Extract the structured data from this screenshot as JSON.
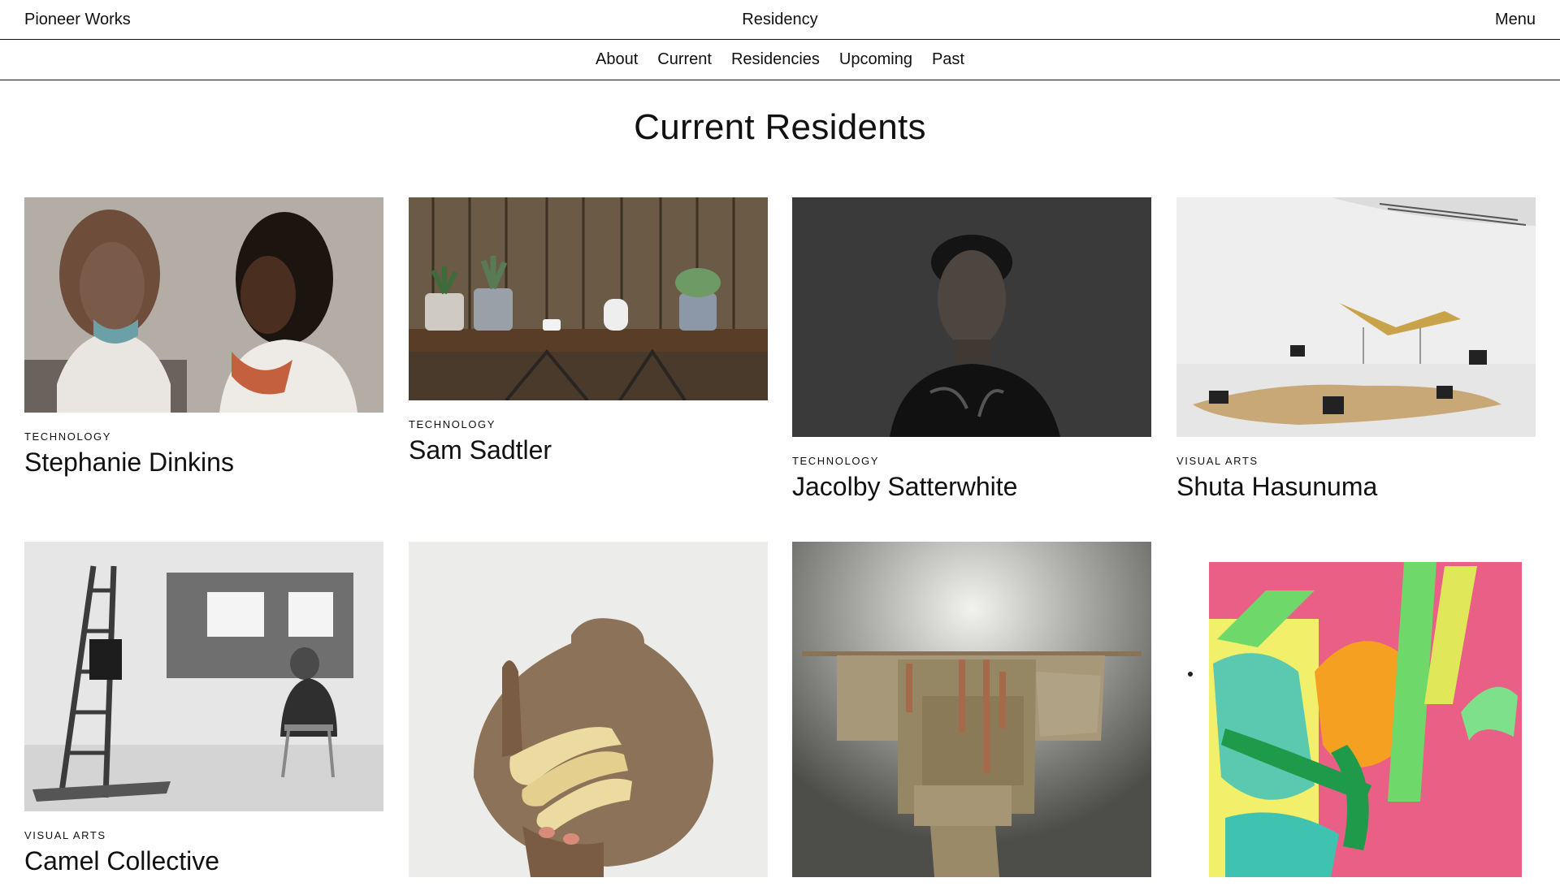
{
  "header": {
    "brand": "Pioneer Works",
    "title": "Residency",
    "menu_label": "Menu"
  },
  "subnav": {
    "items": [
      "About",
      "Current",
      "Residencies",
      "Upcoming",
      "Past"
    ]
  },
  "page_title": "Current Residents",
  "residents": [
    {
      "category": "TECHNOLOGY",
      "name": "Stephanie Dinkins"
    },
    {
      "category": "TECHNOLOGY",
      "name": "Sam Sadtler"
    },
    {
      "category": "TECHNOLOGY",
      "name": "Jacolby Satterwhite"
    },
    {
      "category": "VISUAL ARTS",
      "name": "Shuta Hasunuma"
    },
    {
      "category": "VISUAL ARTS",
      "name": "Camel Collective"
    },
    {
      "category": "",
      "name": ""
    },
    {
      "category": "",
      "name": ""
    },
    {
      "category": "",
      "name": ""
    }
  ]
}
